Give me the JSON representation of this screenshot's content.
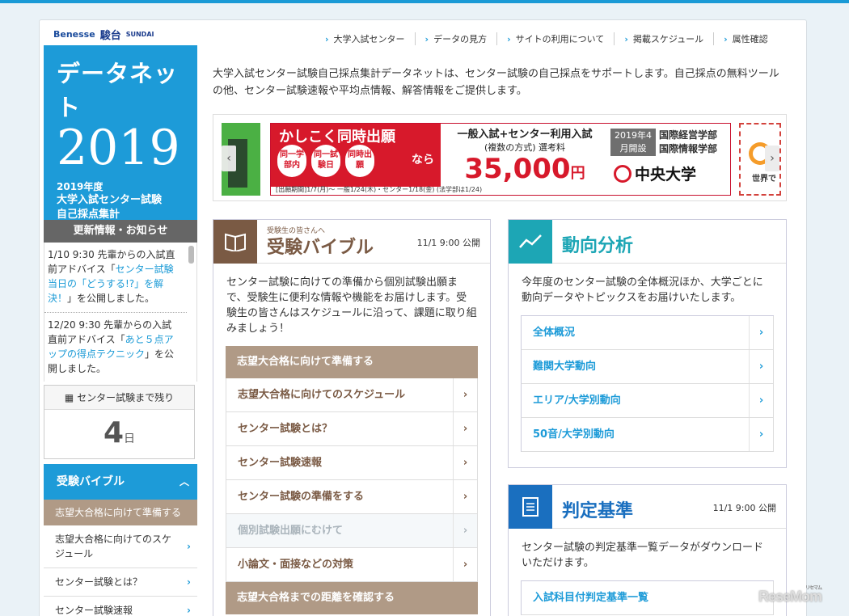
{
  "header": {
    "logo_benesse": "Benesse",
    "logo_sundai_kanji": "駿台",
    "logo_sundai": "SUNDAI",
    "links": [
      "大学入試センター",
      "データの見方",
      "サイトの利用について",
      "掲載スケジュール",
      "属性確認"
    ]
  },
  "hero": {
    "title": "データネット",
    "year": "2019",
    "line1": "2019年度",
    "line2": "大学入試センター試験",
    "line3": "自己採点集計"
  },
  "intro": "大学入試センター試験自己採点集計データネットは、センター試験の自己採点をサポートします。自己採点の無料ツールの他、センター試験速報や平均点情報、解答情報をご提供します。",
  "news": {
    "title": "更新情報・お知らせ",
    "items": [
      {
        "pre": "1/10 9:30 先輩からの入試直前アドバイス「",
        "link": "センター試験当日の「どうする!?」を解決！",
        "post": "」を公開しました。"
      },
      {
        "pre": "12/20 9:30 先輩からの入試直前アドバイス「",
        "link": "あと５点アップの得点テクニック",
        "post": "」を公開しました。"
      }
    ]
  },
  "countdown": {
    "label": "センター試験まで残り",
    "days": "4",
    "unit": "日"
  },
  "sidenav": {
    "header": "受験バイブル",
    "selected": "志望大合格に向けて準備する",
    "items": [
      "志望大合格に向けてのスケジュール",
      "センター試験とは？",
      "センター試験速報"
    ]
  },
  "banner": {
    "headline": "かしこく同時出願",
    "circles": [
      "同一学部内",
      "同一試験日",
      "同時出願"
    ],
    "nara": "なら",
    "line_a": "一般入試+センター利用入試",
    "line_b": "(複数の方式) 選考料",
    "price": "35,000",
    "yen": "円",
    "year_open": "2019年4月開設",
    "fac1": "国際経営学部",
    "fac2": "国際情報学部",
    "univ": "中央大学",
    "footer": "[出願期間]1/7(月)〜 一般1/24(木)・センター1/18(金) (法学部は1/24)",
    "right_text": "世界で"
  },
  "bible": {
    "sub": "受験生の皆さんへ",
    "title": "受験バイブル",
    "date": "11/1 9:00 公開",
    "desc": "センター試験に向けての準備から個別試験出願まで、受験生に便利な情報や機能をお届けします。受験生の皆さんはスケジュールに沿って、課題に取り組みましょう！",
    "section1": "志望大合格に向けて準備する",
    "rows": [
      "志望大合格に向けてのスケジュール",
      "センター試験とは？",
      "センター試験速報",
      "センター試験の準備をする",
      "個別試験出願にむけて",
      "小論文・面接などの対策"
    ],
    "section2": "志望大合格までの距離を確認する"
  },
  "trend": {
    "title": "動向分析",
    "desc": "今年度のセンター試験の全体概況ほか、大学ごとに動向データやトピックスをお届けいたします。",
    "rows": [
      "全体概況",
      "難関大学動向",
      "エリア/大学別動向",
      "50音/大学別動向"
    ]
  },
  "judge": {
    "title": "判定基準",
    "date": "11/1 9:00 公開",
    "desc": "センター試験の判定基準一覧データがダウンロードいただけます。",
    "rows": [
      "入試科目付判定基準一覧"
    ]
  },
  "watermark": {
    "text": "ReseMom",
    "sub": "リセマム"
  },
  "colors": {
    "accent": "#1d9bd8",
    "brown": "#b09a86",
    "bible": "#7a5a44",
    "teal": "#1da6b5",
    "judge_blue": "#1a6fbf"
  },
  "icons": [
    "book-icon",
    "chart-icon",
    "document-icon",
    "calendar-icon",
    "chevron-right-icon",
    "chevron-up-icon",
    "chevron-left-icon"
  ]
}
